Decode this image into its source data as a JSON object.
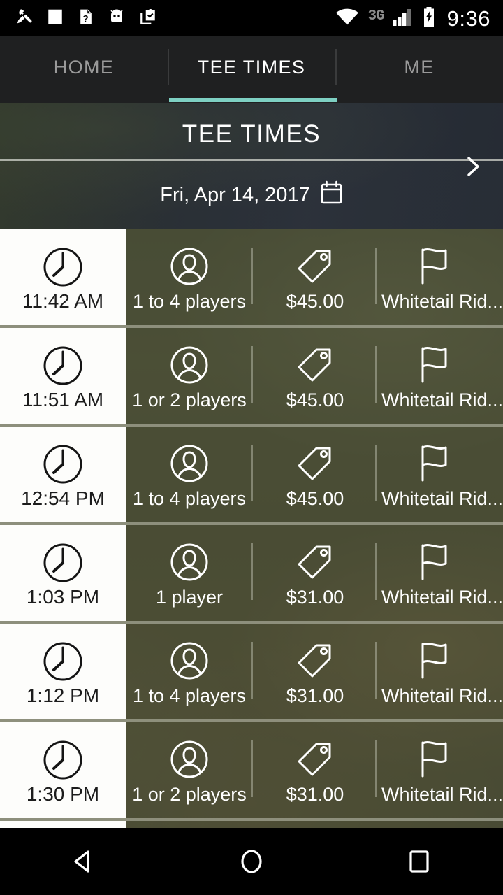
{
  "status_bar": {
    "time": "9:36",
    "network_label": "3G",
    "left_icons": [
      "wrench-icon",
      "white-square-icon",
      "sdcard-question-icon",
      "android-head-icon",
      "clipboard-check-icon"
    ],
    "right_icons": [
      "wifi-icon",
      "signal-bars-icon",
      "battery-charging-icon"
    ]
  },
  "tabs": [
    {
      "label": "HOME",
      "active": false
    },
    {
      "label": "TEE TIMES",
      "active": true
    },
    {
      "label": "ME",
      "active": false
    }
  ],
  "header": {
    "title": "TEE TIMES",
    "date": "Fri, Apr 14, 2017",
    "calendar_icon": "calendar-icon",
    "next_icon": "chevron-right-icon"
  },
  "colors": {
    "accent_teal": "#7ed0c3",
    "tab_bar_bg": "#1f2021",
    "row_time_bg": "#fdfdfb",
    "row_divider": "#969886",
    "text_dark": "#1c1c1c",
    "text_light": "#ffffff",
    "tab_inactive": "#9a9a9a",
    "status_3g": "#8c8c8c"
  },
  "tee_times": [
    {
      "time": "11:42 AM",
      "players": "1 to 4 players",
      "price": "$45.00",
      "course": "Whitetail Rid..."
    },
    {
      "time": "11:51 AM",
      "players": "1 or 2 players",
      "price": "$45.00",
      "course": "Whitetail Rid..."
    },
    {
      "time": "12:54 PM",
      "players": "1 to 4 players",
      "price": "$45.00",
      "course": "Whitetail Rid..."
    },
    {
      "time": "1:03 PM",
      "players": "1 player",
      "price": "$31.00",
      "course": "Whitetail Rid..."
    },
    {
      "time": "1:12 PM",
      "players": "1 to 4 players",
      "price": "$31.00",
      "course": "Whitetail Rid..."
    },
    {
      "time": "1:30 PM",
      "players": "1 or 2 players",
      "price": "$31.00",
      "course": "Whitetail Rid..."
    }
  ],
  "row_icons": {
    "time": "clock-icon",
    "players": "person-circle-icon",
    "price": "price-tag-icon",
    "course": "golf-flag-icon"
  },
  "nav_bar": {
    "back": "back-triangle-icon",
    "home": "home-circle-icon",
    "recents": "recents-square-icon"
  }
}
